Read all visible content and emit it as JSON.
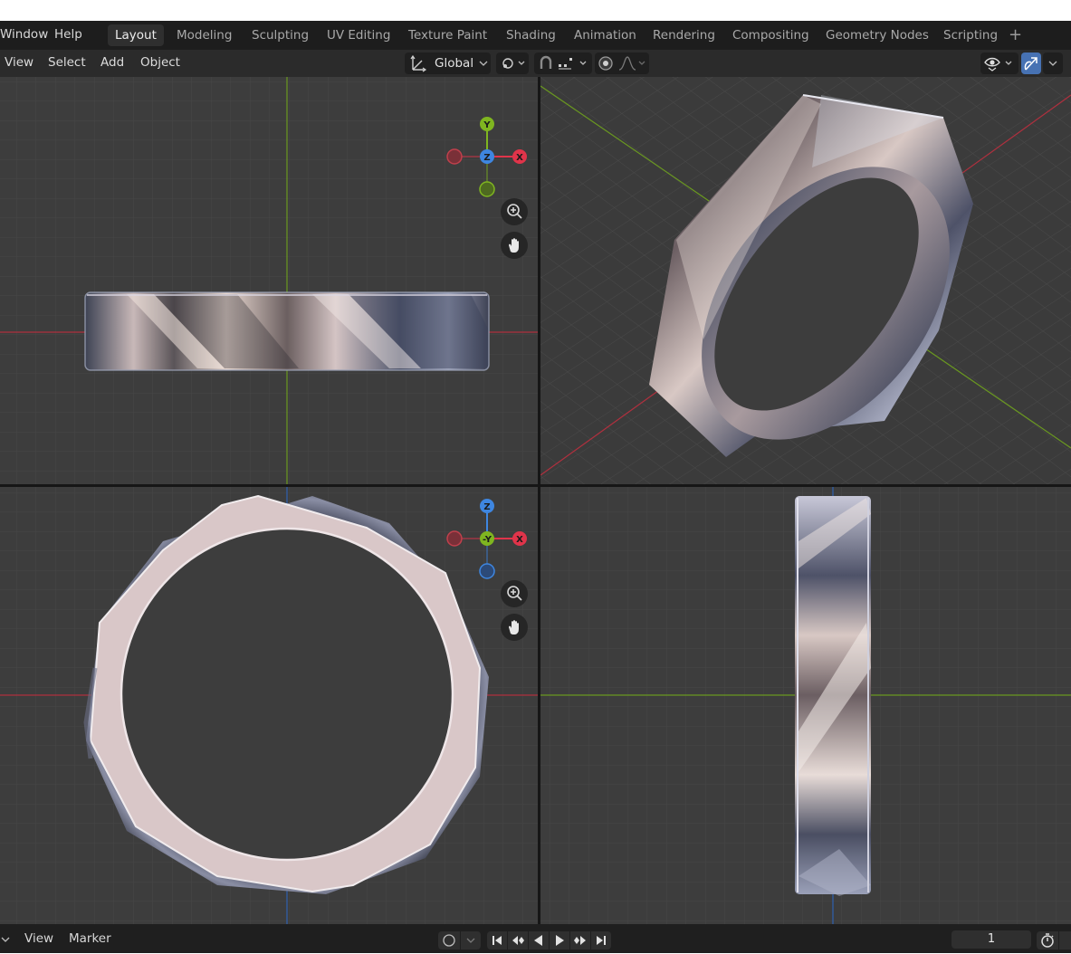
{
  "topbar": {
    "menus": [
      "Window",
      "Help"
    ],
    "workspace_tabs": [
      "Layout",
      "Modeling",
      "Sculpting",
      "UV Editing",
      "Texture Paint",
      "Shading",
      "Animation",
      "Rendering",
      "Compositing",
      "Geometry Nodes",
      "Scripting"
    ],
    "active_tab": "Layout",
    "add_tab_icon": "plus-icon"
  },
  "header": {
    "menus": [
      "View",
      "Select",
      "Add",
      "Object"
    ],
    "transform_orientation": "Global",
    "icons": [
      "transform-orientation-icon",
      "pivot-point-icon",
      "snap-icon",
      "snap-increment-icon",
      "proportional-edit-icon",
      "proportional-falloff-icon",
      "visibility-icon",
      "gizmo-toggle-icon"
    ]
  },
  "viewports": {
    "front_gizmo": {
      "up": "Y",
      "right": "X",
      "center": "Z"
    },
    "side_gizmo": {
      "up": "Z",
      "right": "X",
      "center": "-Y"
    },
    "colors": {
      "x": "#e0344a",
      "y": "#7fb520",
      "z": "#3e86e0",
      "bg": "#3d3d3d",
      "grid": "#474747"
    }
  },
  "timeline": {
    "menus": [
      "View",
      "Marker"
    ],
    "current_frame": "1"
  }
}
